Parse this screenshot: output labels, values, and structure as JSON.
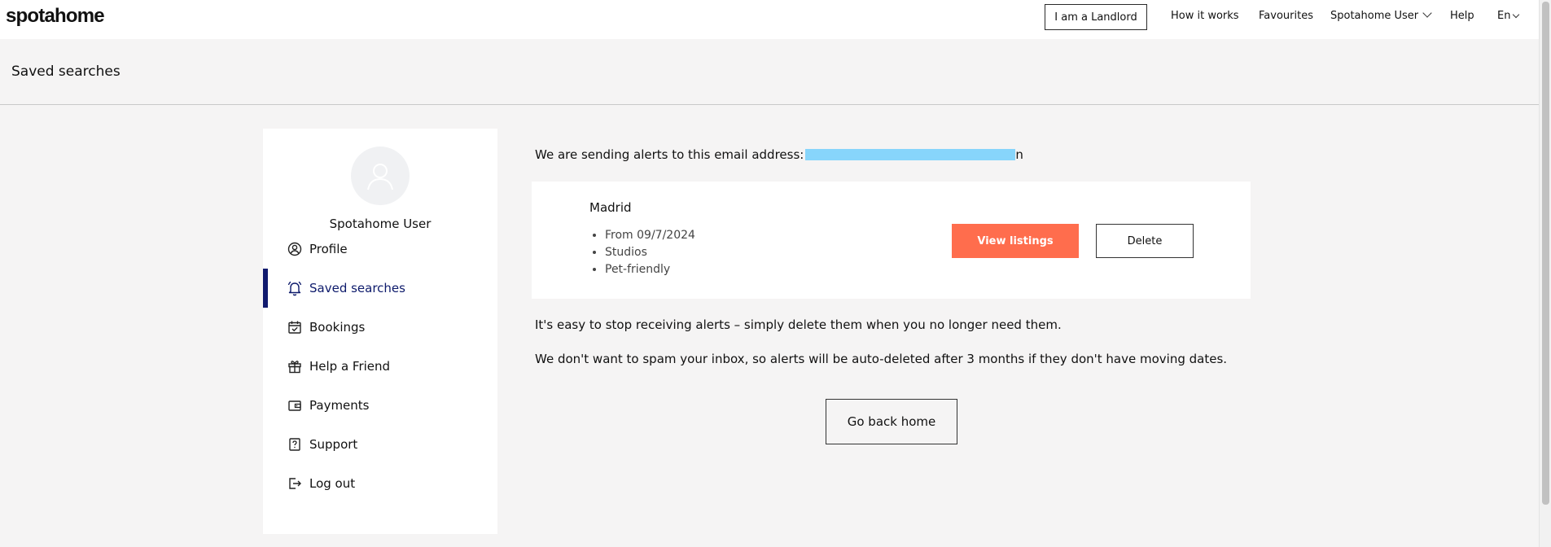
{
  "header": {
    "logo": "spotahome",
    "landlord_button": "I am a Landlord",
    "how_it_works": "How it works",
    "favourites": "Favourites",
    "user_menu": "Spotahome User",
    "help": "Help",
    "language": "En"
  },
  "page": {
    "title": "Saved searches"
  },
  "sidebar": {
    "user_name": "Spotahome User",
    "items": [
      {
        "label": "Profile",
        "icon": "profile-icon"
      },
      {
        "label": "Saved searches",
        "icon": "bell-icon",
        "active": true
      },
      {
        "label": "Bookings",
        "icon": "calendar-check-icon"
      },
      {
        "label": "Help a Friend",
        "icon": "gift-icon"
      },
      {
        "label": "Payments",
        "icon": "wallet-icon"
      },
      {
        "label": "Support",
        "icon": "question-icon"
      },
      {
        "label": "Log out",
        "icon": "logout-icon"
      }
    ]
  },
  "main": {
    "alert_intro": "We are sending alerts to this email address:",
    "email_visible_tail": "n",
    "saved_search": {
      "city": "Madrid",
      "criteria": [
        "From 09/7/2024",
        "Studios",
        "Pet-friendly"
      ],
      "view_button": "View listings",
      "delete_button": "Delete"
    },
    "info_stop": "It's easy to stop receiving alerts – simply delete them when you no longer need them.",
    "info_autodelete": "We don't want to spam your inbox, so alerts will be auto-deleted after 3 months if they don't have moving dates.",
    "go_home_button": "Go back home"
  },
  "colors": {
    "accent": "#ff6d4d",
    "active_nav": "#101a6e",
    "email_mask": "#87d5fb",
    "page_bg": "#f5f4f4"
  }
}
